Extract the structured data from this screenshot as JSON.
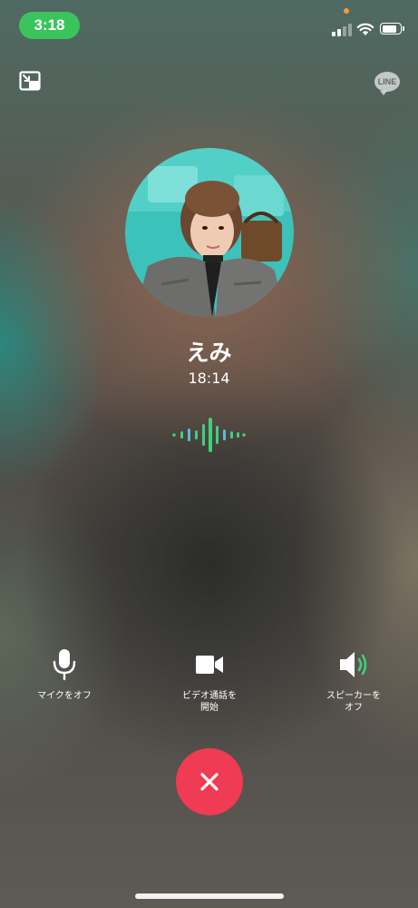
{
  "status_bar": {
    "time": "3:18",
    "icons": [
      "cellular-signal-icon",
      "wifi-icon",
      "battery-icon"
    ],
    "pill_color": "#3bc45b"
  },
  "top_bar": {
    "minimize_icon": "picture-in-picture-icon",
    "brand_badge": "LINE"
  },
  "call": {
    "caller_name": "えみ",
    "duration": "18:14",
    "avatar": "profile-photo"
  },
  "controls": {
    "mute": {
      "icon": "microphone-icon",
      "label": "マイクをオフ"
    },
    "video": {
      "icon": "video-camera-icon",
      "label": "ビデオ通話を\n開始"
    },
    "speaker": {
      "icon": "speaker-on-icon",
      "label": "スピーカーを\nオフ"
    },
    "end_call": {
      "icon": "close-icon",
      "color": "#ef3b53"
    }
  },
  "colors": {
    "accent_green": "#3bc45b",
    "end_call_red": "#ef3b53",
    "wave_green": "#3ed07c",
    "wave_blue": "#5fb8dc"
  }
}
